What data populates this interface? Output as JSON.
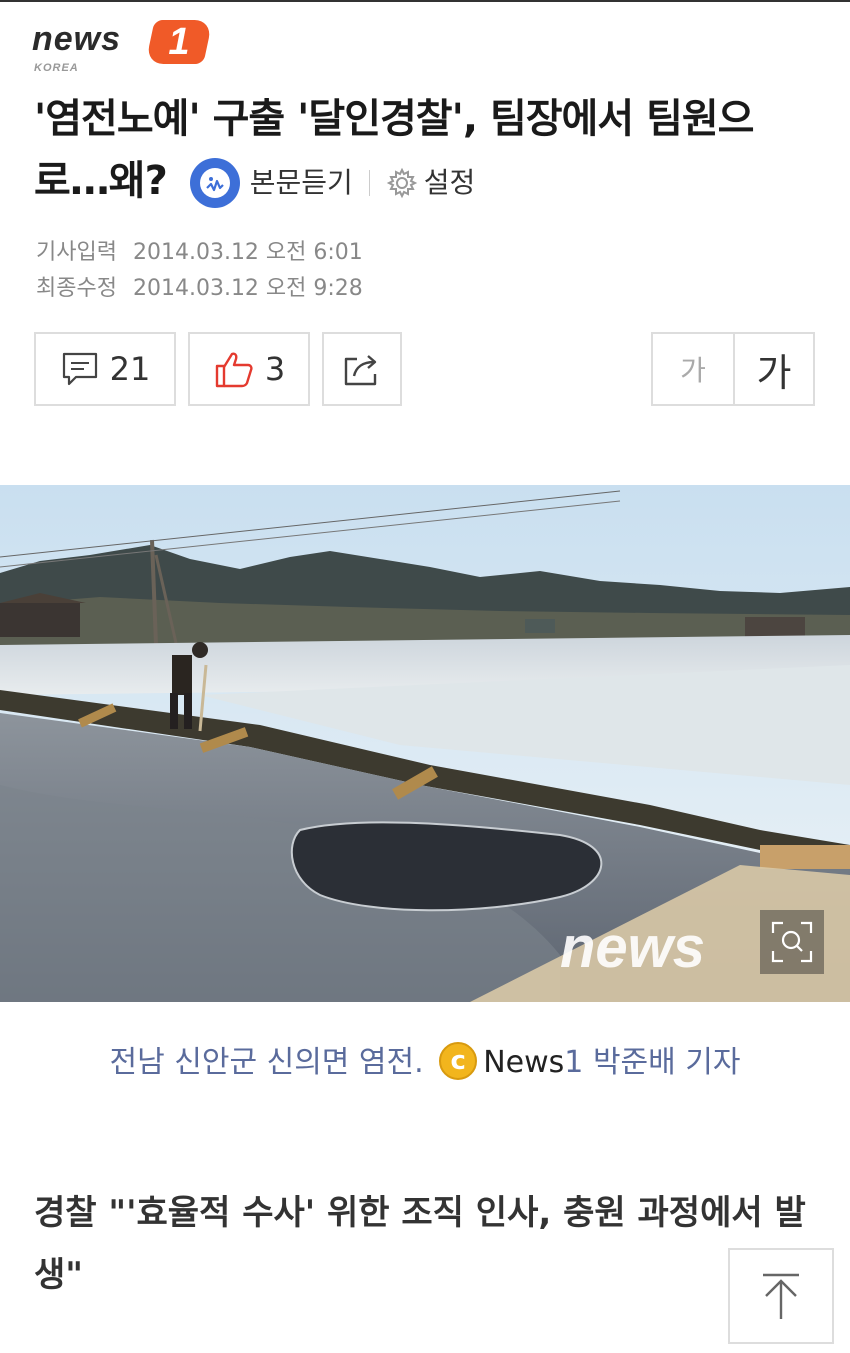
{
  "brand": {
    "logo_text": "news",
    "logo_badge": "1",
    "logo_sub": "KOREA",
    "accent": "#f05a28"
  },
  "article": {
    "title": "'염전노예' 구출 '달인경찰', 팀장에서 팀원으로…왜?",
    "listen_label": "본문듣기",
    "settings_label": "설정",
    "published_label": "기사입력",
    "published_value": "2014.03.12 오전 6:01",
    "modified_label": "최종수정",
    "modified_value": "2014.03.12 오전 9:28"
  },
  "actions": {
    "comment_count": "21",
    "like_count": "3",
    "font_small": "가",
    "font_large": "가"
  },
  "photo": {
    "watermark": "news",
    "caption_text": "전남 신안군 신의면 염전.",
    "copyright_symbol": "c",
    "source_name": "News",
    "source_num": "1",
    "reporter": "박준배 기자"
  },
  "body": {
    "subheading": "경찰 \"'효율적 수사' 위한 조직 인사, 충원 과정에서 발생\""
  },
  "icons": {
    "listen": "speaker-face-icon",
    "settings": "gear-icon",
    "comment": "comment-icon",
    "like": "thumbs-up-icon",
    "share": "share-icon",
    "zoom": "zoom-icon",
    "top": "arrow-up-icon"
  }
}
